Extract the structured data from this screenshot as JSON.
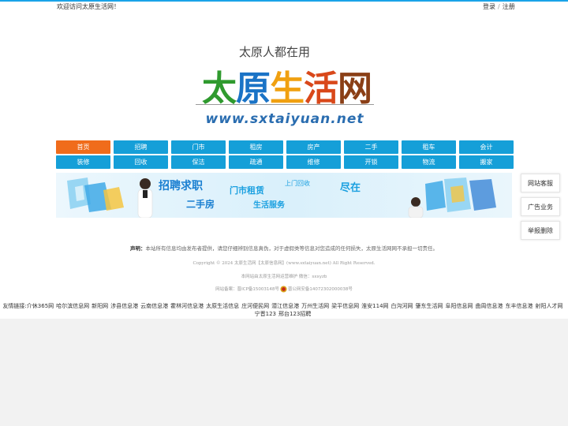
{
  "topbar": {
    "welcome": "欢迎访问太原生活网！",
    "login": "登录",
    "separator": "/",
    "register": "注册"
  },
  "logo": {
    "slogan": "太原人都在用",
    "name_chars": [
      "太",
      "原",
      "生",
      "活",
      "网"
    ],
    "name_colors": [
      "#2f9a2e",
      "#1a73c6",
      "#f0a010",
      "#d9481a",
      "#8a3f16"
    ],
    "url": "www.sxtaiyuan.net"
  },
  "nav": {
    "active": "首页",
    "row1": [
      "首页",
      "招聘",
      "门市",
      "租房",
      "房产",
      "二手",
      "租车",
      "会计"
    ],
    "row2": [
      "装修",
      "回收",
      "保洁",
      "疏通",
      "维修",
      "开锁",
      "物流",
      "搬家"
    ],
    "accent": "#159fd8",
    "active_color": "#f06c1b"
  },
  "banner": {
    "recruit": "招聘求职",
    "shop_rent": "门市租赁",
    "recycle": "上门回收",
    "highlight": "尽在",
    "second_hand": "二手房",
    "life_service": "生活服务"
  },
  "side": {
    "service": "网站客服",
    "ads": "广告业务",
    "report": "举报删除"
  },
  "footer": {
    "notice_label": "声明：",
    "notice_text": "本站所有信息均由发布者提供，请您仔细辨别信息真伪，对于虚假类等信息对您造成的任何损失，太原生活网网不承担一切责任。",
    "copyright": "Copyright © 2024 太原生活网【太原信息网】(www.sxtaiyuan.net) All Right Reserved.",
    "operator": "本网站由太原生活网运营维护 微信：sxxyzb",
    "icp": "网站备案：晋ICP备15003148号",
    "police": "晋公网安备14072302000038号"
  },
  "friends": {
    "label": "友情链接:",
    "links": [
      "介休365网",
      "哈尔滨信息网",
      "新阳网",
      "涉县信息港",
      "云南信息港",
      "霍林河信息港",
      "太原生活信息",
      "庄河便民网",
      "潜江信息港",
      "万州生活网",
      "梁平信息网",
      "淮安114网",
      "白沟河网",
      "肇东生活网",
      "阜阳信息网",
      "曲周信息港",
      "东丰信息港",
      "射阳人才网",
      "宁晋123",
      "邢台123招聘"
    ]
  }
}
